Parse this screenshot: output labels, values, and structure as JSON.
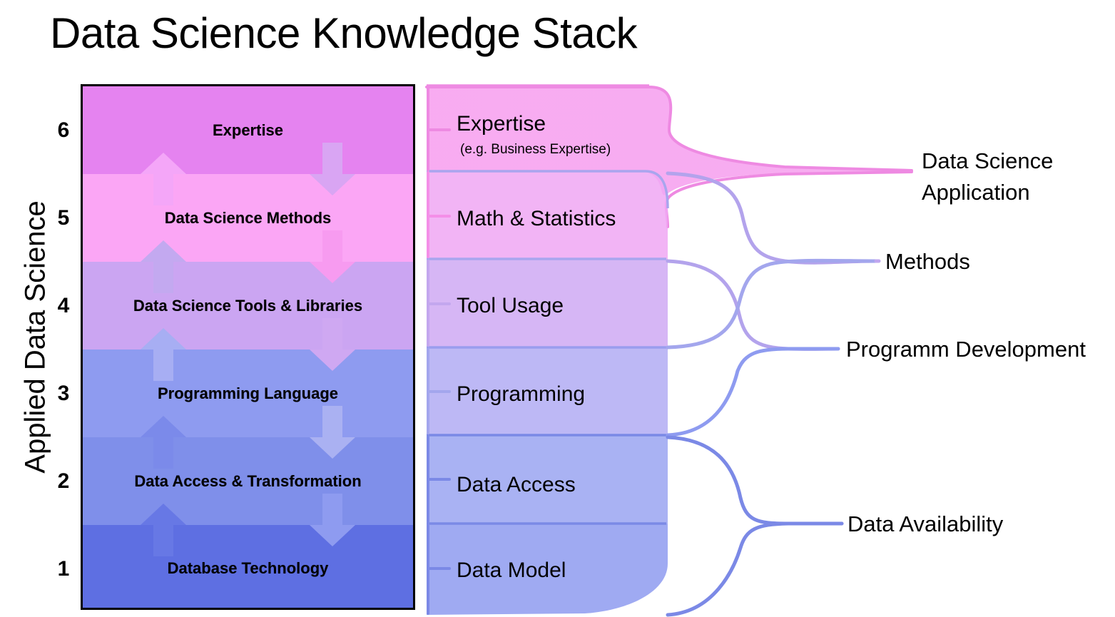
{
  "title": "Data Science Knowledge Stack",
  "axis": {
    "label": "Applied Data Science",
    "ticks": [
      "6",
      "5",
      "4",
      "3",
      "2",
      "1"
    ]
  },
  "stack": {
    "layers": [
      {
        "level": "6",
        "label": "Expertise",
        "color": "#e583f0"
      },
      {
        "level": "5",
        "label": "Data Science Methods",
        "color": "#fba6f5"
      },
      {
        "level": "4",
        "label": "Data Science Tools & Libraries",
        "color": "#cba5f2"
      },
      {
        "level": "3",
        "label": "Programming Language",
        "color": "#8e9bf0"
      },
      {
        "level": "2",
        "label": "Data Access & Transformation",
        "color": "#7f8fea"
      },
      {
        "level": "1",
        "label": "Database Technology",
        "color": "#5e6fe2"
      }
    ],
    "arrow_up_colors": [
      "#f4a6f8",
      "#c3a9f0",
      "#a7aef3",
      "#7b8aea",
      "#6778e5"
    ],
    "arrow_down_colors": [
      "#d9a5f3",
      "#f79bf0",
      "#cfa8f2",
      "#aab1f2",
      "#8e9bf0"
    ]
  },
  "sankey": {
    "nodes": [
      {
        "label": "Expertise",
        "sublabel": "(e.g. Business Expertise)"
      },
      {
        "label": "Math & Statistics",
        "sublabel": ""
      },
      {
        "label": "Tool Usage",
        "sublabel": ""
      },
      {
        "label": "Programming",
        "sublabel": ""
      },
      {
        "label": "Data Access",
        "sublabel": ""
      },
      {
        "label": "Data Model",
        "sublabel": ""
      }
    ],
    "outputs": [
      {
        "label": "Data Science Application",
        "lines": [
          "Data Science",
          "Application"
        ],
        "color": "#f09ae8"
      },
      {
        "label": "Methods",
        "lines": [
          "Methods"
        ],
        "color": "#c0a7ef"
      },
      {
        "label": "Programm Development",
        "lines": [
          "Programm Development"
        ],
        "color": "#a6a9ef"
      },
      {
        "label": "Data Availability",
        "lines": [
          "Data Availability"
        ],
        "color": "#7d8be8"
      }
    ],
    "colors": {
      "pink_stroke": "#ee8ae2",
      "violet_stroke": "#b3a3ec",
      "blue_stroke": "#7b89e6",
      "grad_top": "#f9a8f2",
      "grad_mid": "#cbaaf2",
      "grad_bot": "#8e9bf0"
    }
  },
  "chart_data": {
    "type": "diagram",
    "title": "Data Science Knowledge Stack",
    "ylabel": "Applied Data Science",
    "levels": [
      1,
      2,
      3,
      4,
      5,
      6
    ],
    "stack_categories": [
      "Database Technology",
      "Data Access & Transformation",
      "Programming Language",
      "Data Science Tools & Libraries",
      "Data Science Methods",
      "Expertise"
    ],
    "skill_bands": [
      "Data Model",
      "Data Access",
      "Programming",
      "Tool Usage",
      "Math & Statistics",
      "Expertise"
    ],
    "outcomes": [
      "Data Availability",
      "Programm Development",
      "Methods",
      "Data Science Application"
    ],
    "mapping": [
      {
        "from": "Expertise",
        "to": "Data Science Application"
      },
      {
        "from": "Math & Statistics",
        "to": "Methods"
      },
      {
        "from": "Tool Usage",
        "to": "Programm Development"
      },
      {
        "from": "Programming",
        "to": "Methods"
      },
      {
        "from": "Programming",
        "to": "Programm Development"
      },
      {
        "from": "Data Access",
        "to": "Data Availability"
      },
      {
        "from": "Data Model",
        "to": "Data Availability"
      }
    ]
  }
}
